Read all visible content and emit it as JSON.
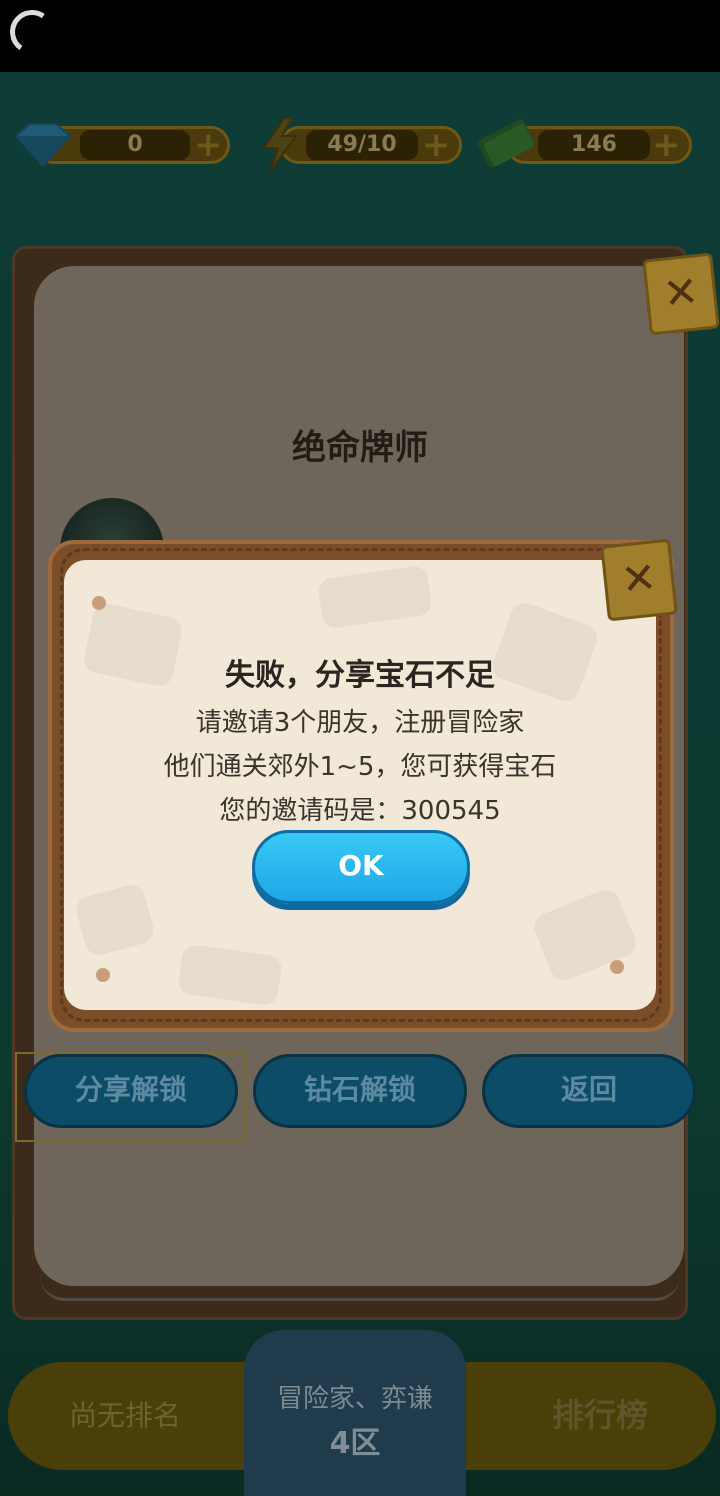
{
  "currency": {
    "gems": "0",
    "energy": "49/10",
    "cash": "146",
    "plus": "+"
  },
  "panel": {
    "title": "绝命牌师",
    "close_glyph": "✕"
  },
  "dialog": {
    "title": "失败，分享宝石不足",
    "line1": "请邀请3个朋友，注册冒险家",
    "line2": "他们通关郊外1~5，您可获得宝石",
    "line3": "您的邀请码是：300545",
    "ok_label": "OK",
    "close_glyph": "✕"
  },
  "actions": {
    "share_unlock": "分享解锁",
    "gem_unlock": "钻石解锁",
    "back": "返回"
  },
  "bottom_bar": {
    "rank_text": "尚无排名",
    "server_line1": "冒险家、弈谦",
    "server_line2": "4区",
    "leaderboard": "排行榜"
  },
  "colors": {
    "ok_button": "#1ea6e6",
    "dialog_paper": "#f1e8d7",
    "dialog_frame": "#7b4d28"
  }
}
